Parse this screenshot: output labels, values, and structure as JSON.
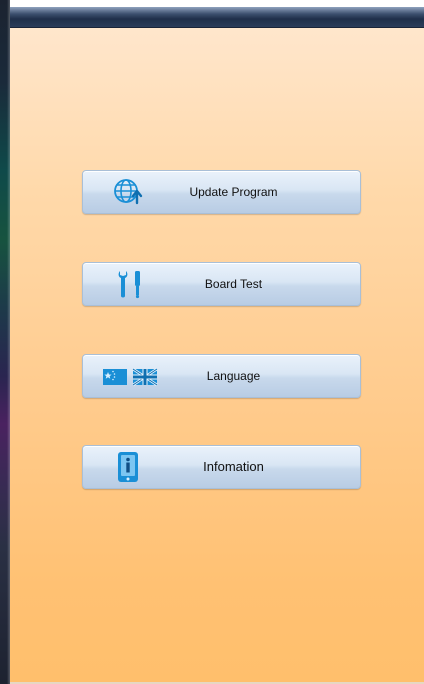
{
  "menu": {
    "items": [
      {
        "label": "Update Program",
        "icon": "globe-upload-icon"
      },
      {
        "label": "Board Test",
        "icon": "tools-icon"
      },
      {
        "label": "Language",
        "icon": "language-flags-icon"
      },
      {
        "label": "Infomation",
        "icon": "info-icon"
      }
    ]
  },
  "colors": {
    "panel_top": "#ffe6cc",
    "panel_bottom": "#ffbf6c",
    "button_top": "#eaf2fb",
    "button_bottom": "#b8cce4",
    "icon_blue": "#1a8fd6",
    "title_bar": "#1f2f4a"
  }
}
